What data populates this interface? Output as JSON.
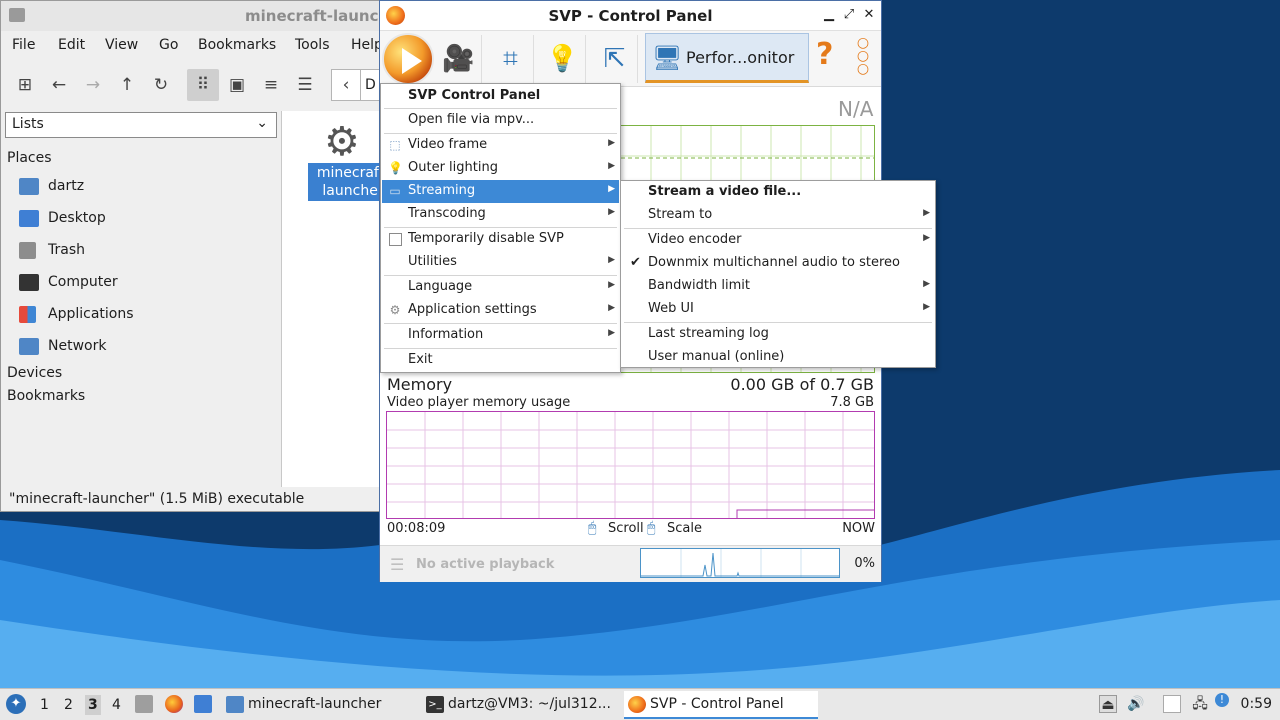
{
  "file_manager": {
    "title": "minecraft-launcher",
    "menu": [
      "File",
      "Edit",
      "View",
      "Go",
      "Bookmarks",
      "Tools",
      "Help"
    ],
    "location_partial": "D",
    "view_mode": "Lists",
    "places_heading": "Places",
    "places": [
      {
        "label": "dartz",
        "icon": "home-folder-icon"
      },
      {
        "label": "Desktop",
        "icon": "desktop-icon"
      },
      {
        "label": "Trash",
        "icon": "trash-icon"
      },
      {
        "label": "Computer",
        "icon": "computer-icon"
      },
      {
        "label": "Applications",
        "icon": "applications-icon"
      },
      {
        "label": "Network",
        "icon": "network-icon"
      }
    ],
    "devices_heading": "Devices",
    "bookmarks_heading": "Bookmarks",
    "file_item": {
      "line1": "minecraft-",
      "line2": "launcher",
      "icon": "gear-icon"
    },
    "status": "\"minecraft-launcher\" (1.5 MiB) executable"
  },
  "svp": {
    "title": "SVP - Control Panel",
    "active_tab": "Perfor...onitor",
    "na_value": "N/A",
    "memory": {
      "title": "Memory",
      "value": "0.00 GB of 0.7 GB",
      "subtitle": "Video player memory usage",
      "max": "7.8 GB",
      "start_time": "00:08:09",
      "scroll_label": "Scroll",
      "scale_label": "Scale",
      "end_time": "NOW"
    },
    "status": {
      "text": "No active playback",
      "percent": "0%"
    },
    "colors": {
      "accent": "#3d89d6",
      "memory_graph": "#b23bb0",
      "cpu_graph": "#7cb342"
    }
  },
  "main_menu": {
    "header": "SVP Control Panel",
    "open_file": "Open file via mpv...",
    "video_frame": "Video frame",
    "outer_lighting": "Outer lighting",
    "streaming": "Streaming",
    "transcoding": "Transcoding",
    "temp_disable": "Temporarily disable SVP",
    "utilities": "Utilities",
    "language": "Language",
    "app_settings": "Application settings",
    "information": "Information",
    "exit": "Exit"
  },
  "streaming_menu": {
    "stream_file": "Stream a video file...",
    "stream_to": "Stream to",
    "video_encoder": "Video encoder",
    "downmix": "Downmix multichannel audio to stereo",
    "downmix_checked": true,
    "bandwidth": "Bandwidth limit",
    "web_ui": "Web UI",
    "last_log": "Last streaming log",
    "user_manual": "User manual (online)"
  },
  "taskbar": {
    "workspaces": [
      "1",
      "2",
      "3",
      "4"
    ],
    "current_workspace": "3",
    "tasks": [
      {
        "label": "minecraft-launcher",
        "icon": "folder-icon"
      },
      {
        "label": "dartz@VM3: ~/jul312...",
        "icon": "terminal-icon"
      },
      {
        "label": "SVP - Control Panel",
        "icon": "svp-icon"
      }
    ],
    "clock": "0:59"
  }
}
